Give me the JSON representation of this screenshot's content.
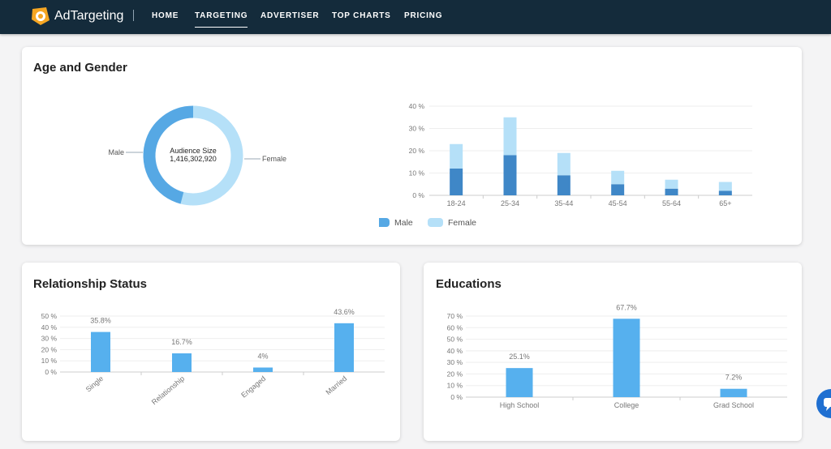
{
  "nav": {
    "brand": "AdTargeting",
    "links": [
      {
        "label": "HOME",
        "active": false
      },
      {
        "label": "TARGETING",
        "active": true
      },
      {
        "label": "ADVERTISER",
        "active": false
      },
      {
        "label": "TOP CHARTS",
        "active": false
      },
      {
        "label": "PRICING",
        "active": false
      }
    ]
  },
  "age_gender": {
    "title": "Age and Gender",
    "donut": {
      "center_label": "Audience Size",
      "center_value": "1,416,302,920",
      "male_label": "Male",
      "female_label": "Female",
      "male_share": 46,
      "female_share": 54
    }
  },
  "relationship": {
    "title": "Relationship Status"
  },
  "educations": {
    "title": "Educations"
  },
  "colors": {
    "male_dark": "#3f87c7",
    "male_legend": "#56a8e4",
    "female_light": "#b5e0f8",
    "bar_blue": "#56b0ee",
    "nav_bg": "#142b3b"
  },
  "chart_data": [
    {
      "type": "bar",
      "stacked": true,
      "categories": [
        "18-24",
        "25-34",
        "35-44",
        "45-54",
        "55-64",
        "65+"
      ],
      "series": [
        {
          "name": "Male",
          "values": [
            12,
            18,
            9,
            5,
            3,
            2
          ]
        },
        {
          "name": "Female",
          "values": [
            11,
            17,
            10,
            6,
            4,
            4
          ]
        }
      ],
      "ylim": [
        0,
        40
      ],
      "yticks": [
        "0 %",
        "10 %",
        "20 %",
        "30 %",
        "40 %"
      ],
      "legend": "bottom"
    },
    {
      "type": "bar",
      "categories": [
        "Single",
        "Relationship",
        "Engaged",
        "Married"
      ],
      "values": [
        35.8,
        16.7,
        4,
        43.6
      ],
      "labels": [
        "35.8%",
        "16.7%",
        "4%",
        "43.6%"
      ],
      "ylim": [
        0,
        50
      ],
      "yticks": [
        "0 %",
        "10 %",
        "20 %",
        "30 %",
        "40 %",
        "50 %"
      ]
    },
    {
      "type": "bar",
      "categories": [
        "High School",
        "College",
        "Grad School"
      ],
      "values": [
        25.1,
        67.7,
        7.2
      ],
      "labels": [
        "25.1%",
        "67.7%",
        "7.2%"
      ],
      "ylim": [
        0,
        70
      ],
      "yticks": [
        "0 %",
        "10 %",
        "20 %",
        "30 %",
        "40 %",
        "50 %",
        "60 %",
        "70 %"
      ]
    }
  ]
}
